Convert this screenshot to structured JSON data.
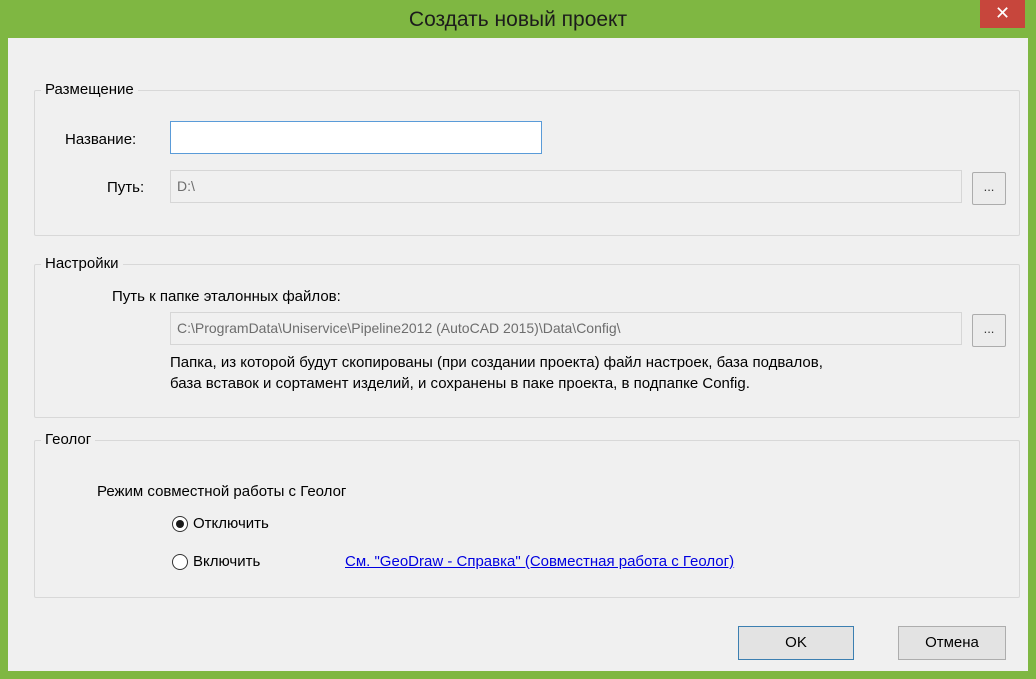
{
  "window": {
    "title": "Создать новый проект",
    "close_glyph": "✕"
  },
  "placement": {
    "legend": "Размещение",
    "name_label": "Название:",
    "name_value": "",
    "path_label": "Путь:",
    "path_value": "D:\\",
    "browse_label": "..."
  },
  "settings": {
    "legend": "Настройки",
    "ref_folder_label": "Путь к папке эталонных файлов:",
    "ref_folder_value": "C:\\ProgramData\\Uniservice\\Pipeline2012 (AutoCAD 2015)\\Data\\Config\\",
    "browse_label": "...",
    "description_line1": "Папка, из которой будут скопированы (при создании проекта) файл настроек, база подвалов,",
    "description_line2": "база вставок и сортамент изделий, и сохранены в паке проекта, в подпапке Config."
  },
  "geolog": {
    "legend": "Геолог",
    "mode_label": "Режим совместной работы с Геолог",
    "options": [
      {
        "label": "Отключить",
        "selected": true
      },
      {
        "label": "Включить",
        "selected": false
      }
    ],
    "help_link": "См. \"GeoDraw - Справка\" (Совместная работа с Геолог)"
  },
  "buttons": {
    "ok": "OK",
    "cancel": "Отмена"
  },
  "colors": {
    "title_bar": "#7fb742",
    "close_button": "#c7463c",
    "link": "#0000e0"
  }
}
